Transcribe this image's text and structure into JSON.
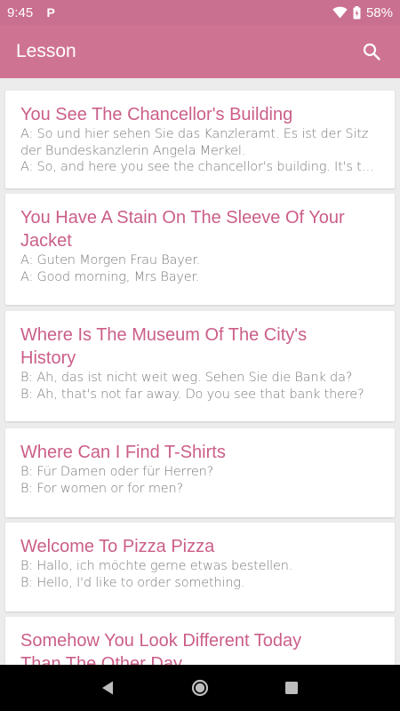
{
  "status_bar": {
    "time": "9:45",
    "notification_letter": "P",
    "battery": "58%"
  },
  "app_bar": {
    "title": "Lesson",
    "icon": "search-icon"
  },
  "lessons": [
    {
      "title": "You See The Chancellor's Building",
      "lines": [
        "A: So und hier sehen Sie das Kanzleramt. Es ist der Sitz",
        "der Bundeskanzlerin Angela Merkel.",
        "A: So, and here you see the chancellor's building. It's th..."
      ]
    },
    {
      "title_lines": [
        "You Have A Stain On The Sleeve Of Your",
        "Jacket"
      ],
      "lines": [
        "A: Guten Morgen Frau Bayer.",
        "A: Good morning, Mrs Bayer."
      ]
    },
    {
      "title_lines": [
        "Where Is The Museum Of The City's",
        "History"
      ],
      "lines": [
        "B: Ah, das ist nicht weit weg. Sehen Sie die Bank da?",
        "B: Ah, that's not far away. Do you see that bank there?"
      ]
    },
    {
      "title": "Where Can I Find T-Shirts",
      "lines": [
        "B: Für Damen oder für Herren?",
        "B: For women or for men?"
      ]
    },
    {
      "title": "Welcome To Pizza Pizza",
      "lines": [
        "B: Hallo, ich möchte gerne etwas bestellen.",
        "B: Hello, I'd like to order something."
      ]
    },
    {
      "title_lines": [
        "Somehow You Look Different Today",
        "Than The Other Day"
      ]
    }
  ],
  "nav_bar": {
    "icons": [
      "back-icon",
      "home-icon",
      "recents-icon"
    ]
  },
  "colors": {
    "status_bar": "#c96f8f",
    "app_bar": "#cf7393",
    "title_text": "#cb5e89",
    "body_text": "#7b7b7b",
    "background": "#ececec"
  }
}
